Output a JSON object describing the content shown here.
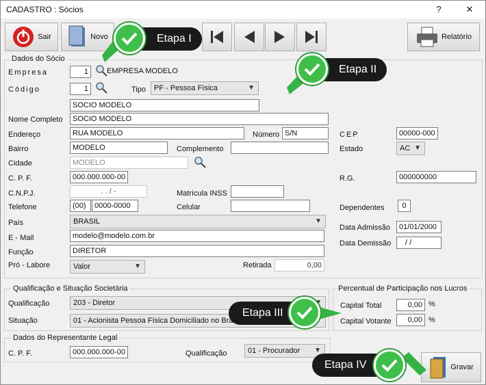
{
  "window": {
    "title": "CADASTRO : Sócios",
    "help": "?",
    "close": "✕"
  },
  "toolbar": {
    "exit": "Sair",
    "new": "Novo",
    "report": "Relatório"
  },
  "steps": {
    "step1": "Etapa I",
    "step2": "Etapa II",
    "step3": "Etapa III",
    "step4": "Etapa IV"
  },
  "partner": {
    "legend": "Dados do Sócio",
    "company_label": "Empresa",
    "company_value": "1",
    "company_name": "EMPRESA MODELO",
    "code_label": "Código",
    "code_value": "1",
    "type_label": "Tipo",
    "type_value": "PF - Pessoa Física",
    "short_name": "SOCIO MODELO",
    "full_name_label": "Nome Completo",
    "full_name": "SOCIO MODELO",
    "address_label": "Endereço",
    "address": "RUA MODELO",
    "number_label": "Número",
    "number": "S/N",
    "zip_label": "CEP",
    "zip": "00000-000",
    "district_label": "Bairro",
    "district": "MODELO",
    "complement_label": "Complemento",
    "complement": "",
    "state_label": "Estado",
    "state": "AC",
    "city_label": "Cidade",
    "city": "MODELO",
    "cpf_label": "C. P. F.",
    "cpf": "000.000.000-00",
    "rg_label": "R.G.",
    "rg": "000000000",
    "cnpj_label": "C.N.P.J.",
    "cnpj": ". . / -",
    "inss_label": "Matrícula INSS",
    "inss": "",
    "phone_label": "Telefone",
    "phone_area": "(00)",
    "phone": "0000-0000",
    "mobile_label": "Celular",
    "mobile": "",
    "dependents_label": "Dependentes",
    "dependents": "0",
    "country_label": "País",
    "country": "BRASIL",
    "admission_label": "Data Admissão",
    "admission": "01/01/2000",
    "email_label": "E - Mail",
    "email": "modelo@modelo.com.br",
    "dismissal_label": "Data Demissão",
    "dismissal": "/ /",
    "role_label": "Função",
    "role": "DIRETOR",
    "prolabore_label": "Pró - Labore",
    "prolabore": "Valor",
    "withdrawal_label": "Retirada",
    "withdrawal": "0,00"
  },
  "qualification": {
    "legend": "Qualificação e Situação Societária",
    "qual_label": "Qualificação",
    "qual_value": "203 - Diretor",
    "status_label": "Situação",
    "status_value": "01 - Acionista Pessoa Física Domiciliado no Brasil"
  },
  "participation": {
    "legend": "Percentual de Participação nos Lucros",
    "capital_total_label": "Capital Total",
    "capital_total": "0,00",
    "capital_voting_label": "Capital Votante",
    "capital_voting": "0,00",
    "percent": "%"
  },
  "legal_rep": {
    "legend": "Dados do Representante Legal",
    "cpf_label": "C. P. F.",
    "cpf": "000.000.000-00",
    "qual_label": "Qualificação",
    "qual_value": "01 - Procurador"
  },
  "save": {
    "label": "Gravar"
  }
}
